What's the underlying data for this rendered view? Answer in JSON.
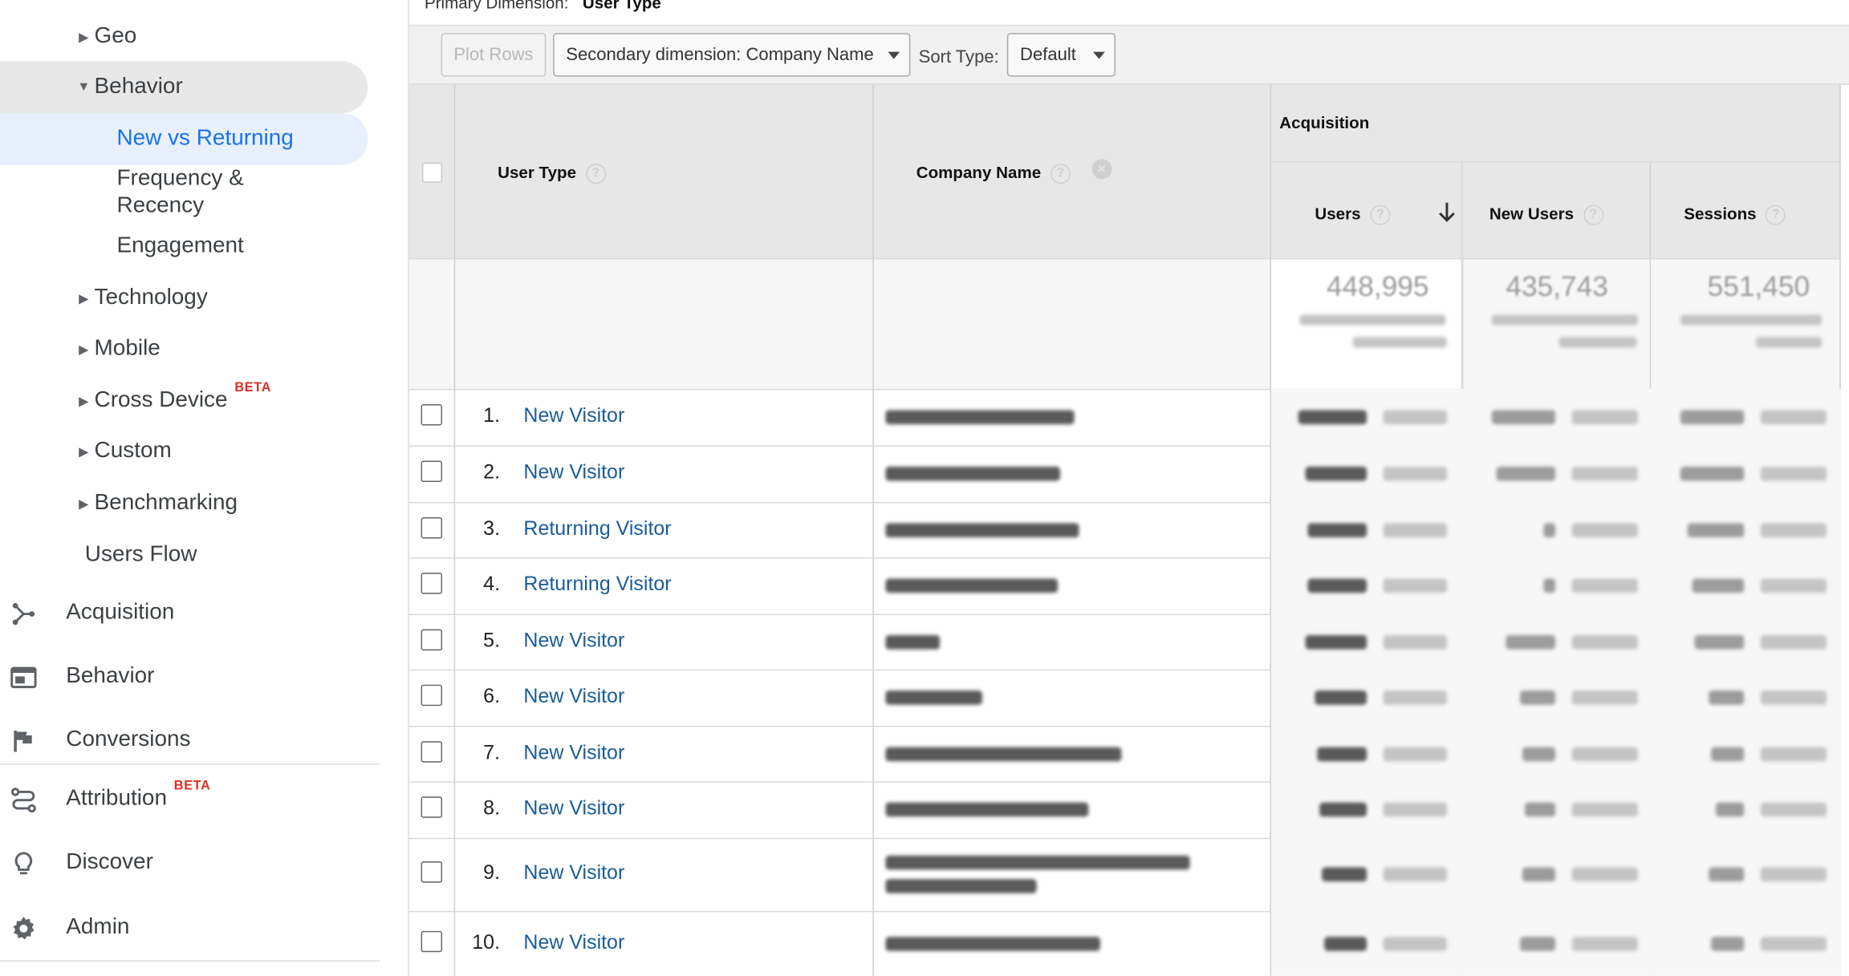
{
  "sidebar": {
    "audience_items": [
      {
        "label": "Geo",
        "caret": "right"
      },
      {
        "label": "Behavior",
        "caret": "down"
      },
      {
        "label": "New vs Returning"
      },
      {
        "label": "Frequency &"
      },
      {
        "label": "Recency"
      },
      {
        "label": "Engagement"
      },
      {
        "label": "Technology",
        "caret": "right"
      },
      {
        "label": "Mobile",
        "caret": "right"
      },
      {
        "label": "Cross Device",
        "badge": "BETA",
        "caret": "right"
      },
      {
        "label": "Custom",
        "caret": "right"
      },
      {
        "label": "Benchmarking",
        "caret": "right"
      },
      {
        "label": "Users Flow"
      }
    ],
    "sections": [
      {
        "label": "Acquisition",
        "icon": "acquisition-icon"
      },
      {
        "label": "Behavior",
        "icon": "behavior-icon"
      },
      {
        "label": "Conversions",
        "icon": "flag-icon"
      },
      {
        "label": "Attribution",
        "icon": "attribution-icon",
        "badge": "BETA"
      },
      {
        "label": "Discover",
        "icon": "lightbulb-icon"
      },
      {
        "label": "Admin",
        "icon": "gear-icon"
      }
    ]
  },
  "main": {
    "primary_dimension_label": "Primary Dimension:",
    "primary_dimension_value": "User Type",
    "toolbar": {
      "plot_rows": "Plot Rows",
      "secondary_dimension": "Secondary dimension: Company Name",
      "sort_type_label": "Sort Type:",
      "sort_type_value": "Default"
    },
    "table": {
      "group_header": "Acquisition",
      "columns": {
        "user_type": "User Type",
        "company_name": "Company Name",
        "users": "Users",
        "new_users": "New Users",
        "sessions": "Sessions"
      },
      "totals": {
        "users": "448,995",
        "new_users": "435,743",
        "sessions": "551,450"
      },
      "rows": [
        {
          "num": "1.",
          "user_type": "New Visitor"
        },
        {
          "num": "2.",
          "user_type": "New Visitor"
        },
        {
          "num": "3.",
          "user_type": "Returning Visitor"
        },
        {
          "num": "4.",
          "user_type": "Returning Visitor"
        },
        {
          "num": "5.",
          "user_type": "New Visitor"
        },
        {
          "num": "6.",
          "user_type": "New Visitor"
        },
        {
          "num": "7.",
          "user_type": "New Visitor"
        },
        {
          "num": "8.",
          "user_type": "New Visitor"
        },
        {
          "num": "9.",
          "user_type": "New Visitor"
        },
        {
          "num": "10.",
          "user_type": "New Visitor"
        }
      ]
    }
  }
}
